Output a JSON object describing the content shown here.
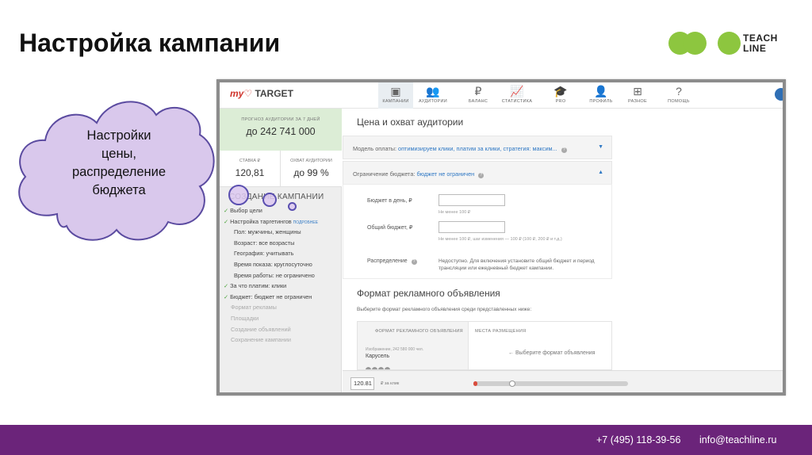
{
  "slide": {
    "title": "Настройка кампании",
    "callout": [
      "Настройки",
      "цены,",
      "распределение",
      "бюджета"
    ]
  },
  "brand": {
    "logo_line1": "TEACH",
    "logo_line2": "LINE",
    "accent": "#8dc63f",
    "footer_color": "#6b247a"
  },
  "footer": {
    "phone": "+7 (495) 118-39-56",
    "email": "info@teachline.ru"
  },
  "app": {
    "logo_my": "my",
    "logo_target": "TARGET",
    "nav": [
      {
        "label": "КАМПАНИИ",
        "icon": "campaign-icon",
        "glyph": "▣",
        "active": true
      },
      {
        "label": "АУДИТОРИИ",
        "icon": "audience-icon",
        "glyph": "👥",
        "active": false
      },
      {
        "label": "БАЛАНС",
        "icon": "ruble-icon",
        "glyph": "₽",
        "active": false
      },
      {
        "label": "СТАТИСТИКА",
        "icon": "chart-icon",
        "glyph": "📈",
        "active": false
      },
      {
        "label": "PRO",
        "icon": "graduation-cap-icon",
        "glyph": "🎓",
        "active": false
      },
      {
        "label": "ПРОФИЛЬ",
        "icon": "user-icon",
        "glyph": "👤",
        "active": false
      },
      {
        "label": "РАЗНОЕ",
        "icon": "grid-icon",
        "glyph": "⊞",
        "active": false
      },
      {
        "label": "ПОМОЩЬ",
        "icon": "help-icon",
        "glyph": "?",
        "active": false
      }
    ],
    "sidebar": {
      "forecast_label": "ПРОГНОЗ АУДИТОРИИ ЗА 7 ДНЕЙ",
      "forecast_value": "до 242 741 000",
      "rate_label": "СТАВКА ₽",
      "rate_value": "120,81",
      "coverage_label": "ОХВАТ АУДИТОРИИ",
      "coverage_value": "до 99 %",
      "create_heading": "СОЗДАНИЕ КАМПАНИИ",
      "steps": [
        {
          "text": "Выбор цели",
          "state": "done"
        },
        {
          "text": "Настройка таргетингов",
          "state": "done",
          "more": "ПОДРОБНЕЕ"
        },
        {
          "text": "Пол: мужчины, женщины",
          "state": "sub"
        },
        {
          "text": "Возраст: все возрасты",
          "state": "sub"
        },
        {
          "text": "География: учитывать",
          "state": "sub"
        },
        {
          "text": "Время показа: круглосуточно",
          "state": "sub"
        },
        {
          "text": "Время работы: не ограничено",
          "state": "sub"
        },
        {
          "text": "За что платим: клики",
          "state": "done"
        },
        {
          "text": "Бюджет: бюджет не ограничен",
          "state": "done"
        },
        {
          "text": "Формат рекламы",
          "state": "dim"
        },
        {
          "text": "Площадки",
          "state": "dim"
        },
        {
          "text": "Создание объявлений",
          "state": "dim"
        },
        {
          "text": "Сохранение кампании",
          "state": "dim"
        }
      ]
    },
    "price": {
      "heading": "Цена и охват аудитории",
      "payment_label": "Модель оплаты:",
      "payment_value": "оптимизируем клики, платим за клики, стратегия: максим...",
      "budget_limit_label": "Ограничение бюджета:",
      "budget_limit_value": "бюджет не ограничен",
      "daily_label": "Бюджет в день, ₽",
      "daily_note": "Не менее 100 ₽",
      "total_label": "Общий бюджет, ₽",
      "total_note": "Не менее 100 ₽, шаг изменения — 100 ₽ (100 ₽, 200 ₽ и т.д.)",
      "distribution_label": "Распределение",
      "distribution_note": "Недоступно. Для включения установите общий бюджет и период трансляции или ежедневный бюджет кампании."
    },
    "format": {
      "heading": "Формат рекламного объявления",
      "subheading": "Выберите формат рекламного объявления среди представленных ниже:",
      "col1": "ФОРМАТ РЕКЛАМНОГО ОБЪЯВЛЕНИЯ",
      "col2": "МЕСТА РАЗМЕЩЕНИЯ",
      "item_note": "Изображение, 242 580 000 чел.",
      "item_name": "Карусель",
      "hint": "← Выберите формат объявления"
    },
    "bottom": {
      "bid_value": "120.81",
      "bid_unit": "₽ за клик",
      "slider_fraction": 0.25
    }
  }
}
